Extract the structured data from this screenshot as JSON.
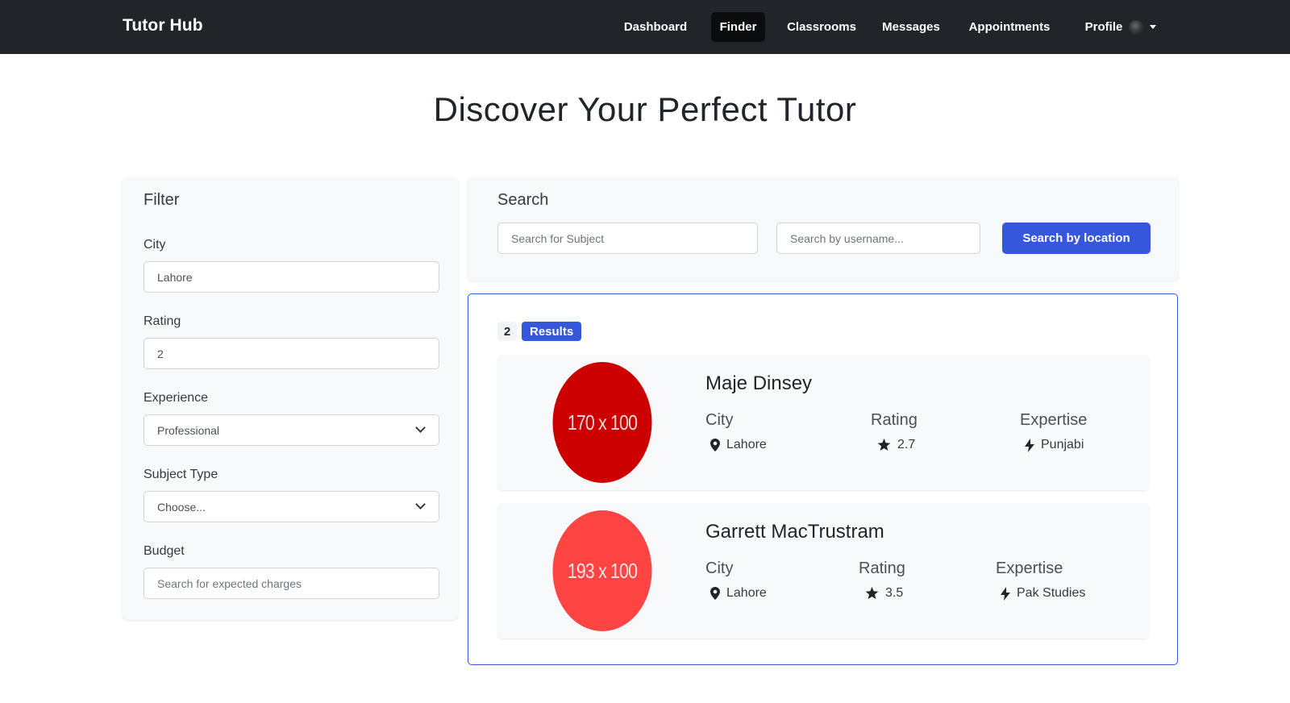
{
  "nav": {
    "brand": "Tutor Hub",
    "items": [
      {
        "label": "Dashboard"
      },
      {
        "label": "Finder"
      },
      {
        "label": "Classrooms"
      },
      {
        "label": "Messages"
      },
      {
        "label": "Appointments"
      },
      {
        "label": "Profile"
      }
    ],
    "active": "Finder"
  },
  "page": {
    "title": "Discover Your Perfect Tutor"
  },
  "filter": {
    "title": "Filter",
    "city": {
      "label": "City",
      "value": "Lahore"
    },
    "rating": {
      "label": "Rating",
      "value": "2"
    },
    "experience": {
      "label": "Experience",
      "value": "Professional"
    },
    "subject_type": {
      "label": "Subject Type",
      "value": "Choose..."
    },
    "budget": {
      "label": "Budget",
      "placeholder": "Search for expected charges"
    }
  },
  "search": {
    "title": "Search",
    "subject_placeholder": "Search for Subject",
    "username_placeholder": "Search by username...",
    "location_button": "Search by location"
  },
  "results": {
    "count": "2",
    "label": "Results",
    "tutors": [
      {
        "name": "Maje Dinsey",
        "avatar_text": "170 x 100",
        "avatar_color": "#cc0000",
        "city_label": "City",
        "city": "Lahore",
        "rating_label": "Rating",
        "rating": "2.7",
        "expertise_label": "Expertise",
        "expertise": "Punjabi"
      },
      {
        "name": "Garrett MacTrustram",
        "avatar_text": "193 x 100",
        "avatar_color": "#ff4444",
        "city_label": "City",
        "city": "Lahore",
        "rating_label": "Rating",
        "rating": "3.5",
        "expertise_label": "Expertise",
        "expertise": "Pak Studies"
      }
    ]
  },
  "colors": {
    "navbar": "#212529",
    "primary": "#3457dc"
  }
}
